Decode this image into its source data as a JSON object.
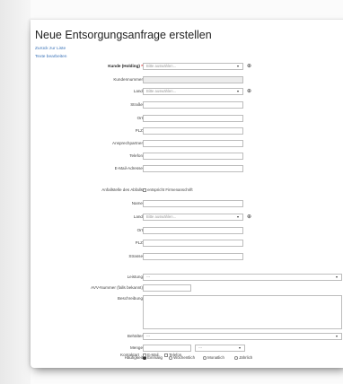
{
  "page": {
    "title": "Neue Entsorgungsanfrage erstellen",
    "link_back": "Zurück zur Liste",
    "link_edit_texts": "Texte bearbeiten"
  },
  "customer": {
    "holding_label": "Kunde (Holding)",
    "required_mark": "*",
    "holding_placeholder": "Bitte auswählen...",
    "number_label": "Kundennummer",
    "country_label": "Land",
    "country_placeholder": "Bitte auswählen...",
    "street_label": "Straße",
    "city_label": "Ort",
    "zip_label": "PLZ",
    "contact_label": "Ansprechpartner",
    "phone_label": "Telefon",
    "email_label": "E-Mail-Adresse"
  },
  "origin": {
    "section_label": "Anfallstelle des Abfalls",
    "same_address_label": "entspricht Firmenanschrift",
    "name_label": "Name",
    "country_label": "Land",
    "country_placeholder": "Bitte auswählen...",
    "city_label": "Ort",
    "zip_label": "PLZ",
    "street_label": "Strasse"
  },
  "service": {
    "service_label": "Leistung",
    "service_value": "---",
    "avv_label": "AVV-Nummer (falls bekannt)",
    "description_label": "Beschreibung",
    "container_label": "Behälter",
    "container_value": "---",
    "quantity_label": "Menge",
    "unit_value": "---",
    "frequency_label": "Häufigkeit",
    "frequency_options": [
      "Einmalig",
      "Wöchentlich",
      "Monatlich",
      "Jährlich"
    ],
    "frequency_selected": "Einmalig",
    "contact_label": "Kontaktart",
    "contact_options": [
      "E-Mail",
      "Telefon"
    ]
  },
  "icons": {
    "add": "add-icon",
    "dropdown": "caret-down-icon"
  },
  "colors": {
    "link": "#3a73b8",
    "required": "#d22"
  }
}
